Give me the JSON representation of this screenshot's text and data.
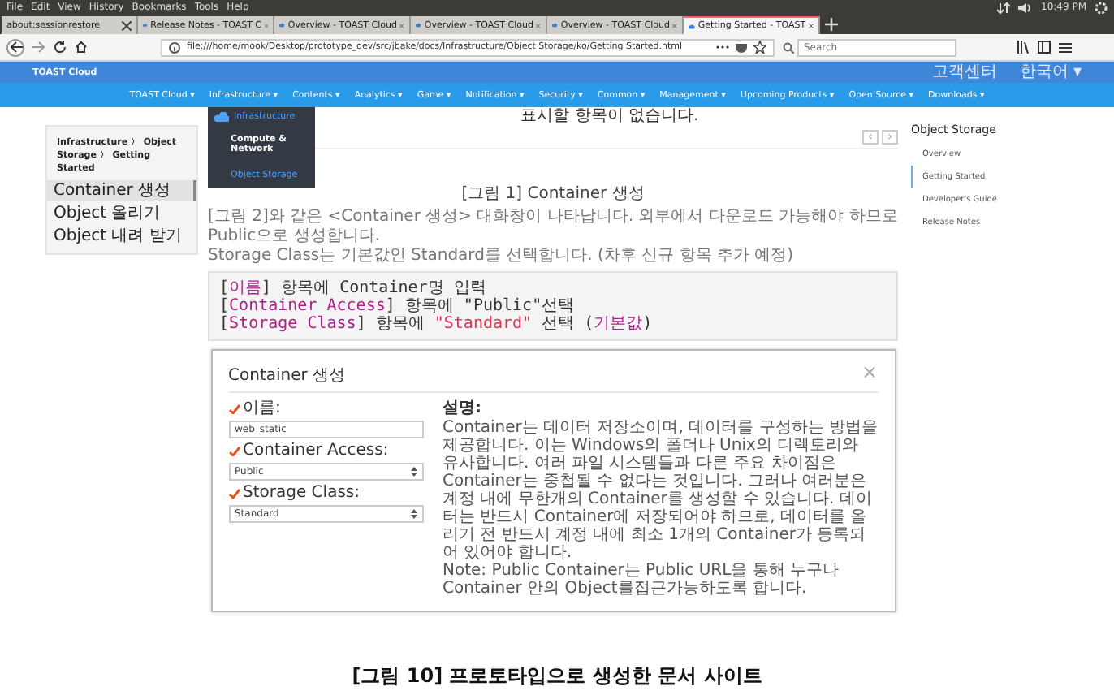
{
  "menu_bar": {
    "items": [
      "File",
      "Edit",
      "View",
      "History",
      "Bookmarks",
      "Tools",
      "Help"
    ],
    "clock": "10:49 PM"
  },
  "tabs": [
    {
      "title": "about:sessionrestore",
      "selected": false,
      "icon": false
    },
    {
      "title": "Release Notes - TOAST C",
      "selected": false,
      "icon": true
    },
    {
      "title": "Overview - TOAST Cloud",
      "selected": false,
      "icon": true
    },
    {
      "title": "Overview - TOAST Cloud",
      "selected": false,
      "icon": true
    },
    {
      "title": "Overview - TOAST Cloud",
      "selected": false,
      "icon": true
    },
    {
      "title": "Getting Started - TOAST",
      "selected": true,
      "icon": true
    }
  ],
  "address_bar": {
    "url": "file:///home/mook/Desktop/prototype_dev/src/jbake/docs/Infrastructure/Object Storage/ko/Getting Started.html",
    "search_placeholder": "Search"
  },
  "site_header": {
    "logo": "TOAST Cloud",
    "support": "고객센터",
    "language": "한국어 ▾"
  },
  "site_nav": {
    "items": [
      "TOAST Cloud ▾",
      "Infrastructure ▾",
      "Contents ▾",
      "Analytics ▾",
      "Game ▾",
      "Notification ▾",
      "Security ▾",
      "Common ▾",
      "Management ▾",
      "Upcoming Products ▾",
      "Open Source ▾",
      "Downloads ▾"
    ]
  },
  "dropdown": {
    "heading": "Infrastructure",
    "items": [
      {
        "label": "Compute & Network",
        "selected": false
      },
      {
        "label": "Object Storage",
        "selected": true
      }
    ]
  },
  "sidebar": {
    "breadcrumb": "Infrastructure 〉 Object Storage 〉 Getting Started",
    "items": [
      {
        "label": "Container 생성",
        "selected": true
      },
      {
        "label": "Object 올리기",
        "selected": false
      },
      {
        "label": "Object 내려 받기",
        "selected": false
      }
    ]
  },
  "content": {
    "empty_notice": "표시할 항목이 없습니다.",
    "pager": [
      "‹",
      "›"
    ],
    "figure_caption": "[그림 1] Container 생성",
    "paragraph": [
      "[그림 2]와 같은 <Container 생성> 대화창이 나타납니다. 외부에서 다운로드 가능해야 하므로 Public으로 생성합니다.",
      "Storage Class는 기본값인 Standard를 선택합니다. (차후 신규 항목 추가 예정)"
    ],
    "code_lines": [
      [
        {
          "kind": "plain",
          "text": "["
        },
        {
          "kind": "keyword",
          "text": "이름"
        },
        {
          "kind": "plain",
          "text": "] 항목에 Container명 입력"
        }
      ],
      [
        {
          "kind": "plain",
          "text": "["
        },
        {
          "kind": "keyword",
          "text": "Container Access"
        },
        {
          "kind": "plain",
          "text": "] 항목에 \"Public\"선택"
        }
      ],
      [
        {
          "kind": "plain",
          "text": "["
        },
        {
          "kind": "keyword",
          "text": "Storage Class"
        },
        {
          "kind": "plain",
          "text": "] 항목에 "
        },
        {
          "kind": "string",
          "text": "\"Standard\""
        },
        {
          "kind": "plain",
          "text": " 선택 ("
        },
        {
          "kind": "keyword",
          "text": "기본값"
        },
        {
          "kind": "plain",
          "text": ")"
        }
      ]
    ],
    "dialog": {
      "title": "Container 생성",
      "close": "×",
      "fields": [
        {
          "label": "이름:",
          "kind": "input",
          "value": "web_static"
        },
        {
          "label": "Container Access:",
          "kind": "select",
          "value": "Public"
        },
        {
          "label": "Storage Class:",
          "kind": "select",
          "value": "Standard"
        }
      ],
      "description_title": "설명:",
      "description": [
        "Container는 데이터 저장소이며, 데이터를 구성하는 방법을 제공합니다. 이는 Windows의 폴더나 Unix의 디렉토리와 유사합니다. 여러 파일 시스템들과 다른 주요 차이점은 Container는 중첩될 수 없다는 것입니다. 그러나 여러분은 계정 내에 무한개의 Container를 생성할 수 있습니다. 데이터는 반드시 Container에 저장되어야 하므로, 데이터를 올리기 전 반드시 계정 내에 최소 1개의 Container가 등록되어 있어야 합니다.",
        "Note: Public Container는 Public URL을 통해 누구나 Container 안의 Object를접근가능하도록 합니다."
      ]
    }
  },
  "toc": {
    "title": "Object Storage",
    "items": [
      {
        "label": "Overview",
        "selected": false
      },
      {
        "label": "Getting Started",
        "selected": true
      },
      {
        "label": "Developer's Guide",
        "selected": false
      },
      {
        "label": "Release Notes",
        "selected": false
      }
    ]
  },
  "document_caption": "[그림 10] 프로토타입으로 생성한 문서 사이트"
}
